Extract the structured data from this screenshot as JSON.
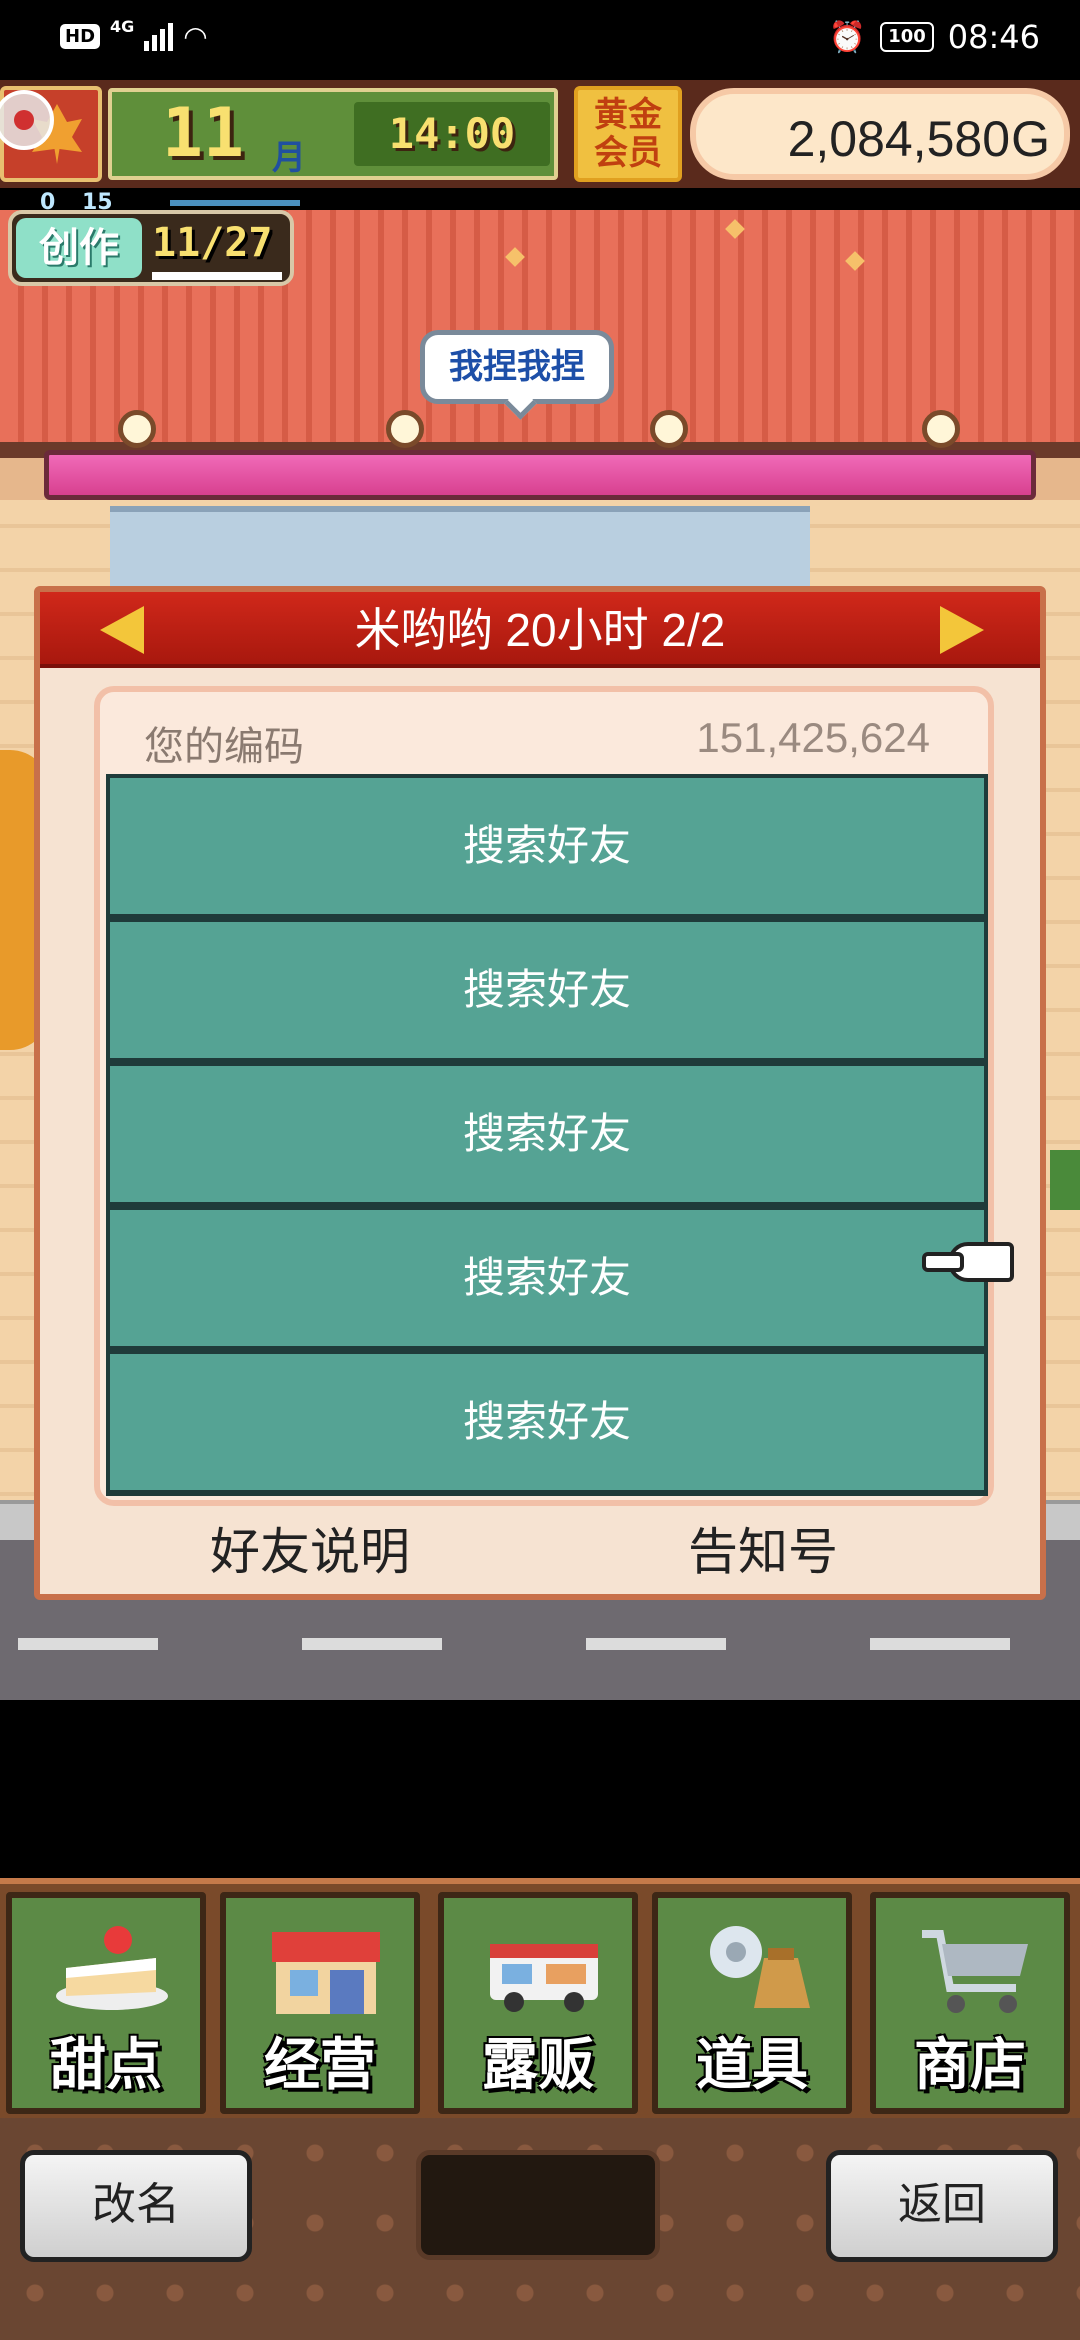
{
  "status_bar": {
    "hd": "HD",
    "network": "4G",
    "battery": "100",
    "time": "08:46"
  },
  "hud": {
    "month": "11",
    "month_unit": "月",
    "clock": "14:00",
    "member": "黄金会员",
    "gold": "2,084,580",
    "gold_unit": "G"
  },
  "create": {
    "label": "创作",
    "count": "11/27",
    "mini_left": "0",
    "mini_right": "15"
  },
  "speech_bubble": "我捏我捏",
  "dialog": {
    "title": "米哟哟  20小时 2/2",
    "code_label": "您的编码",
    "code_value": "151,425,624",
    "friend_slots": [
      "搜索好友",
      "搜索好友",
      "搜索好友",
      "搜索好友",
      "搜索好友"
    ],
    "footer_left": "好友说明",
    "footer_right": "告知号"
  },
  "menu": [
    {
      "label": "甜点",
      "icon": "cake-icon"
    },
    {
      "label": "经营",
      "icon": "shop-icon"
    },
    {
      "label": "露贩",
      "icon": "food-truck-icon"
    },
    {
      "label": "道具",
      "icon": "items-icon"
    },
    {
      "label": "商店",
      "icon": "cart-icon"
    }
  ],
  "bottom_buttons": {
    "rename": "改名",
    "back": "返回"
  }
}
